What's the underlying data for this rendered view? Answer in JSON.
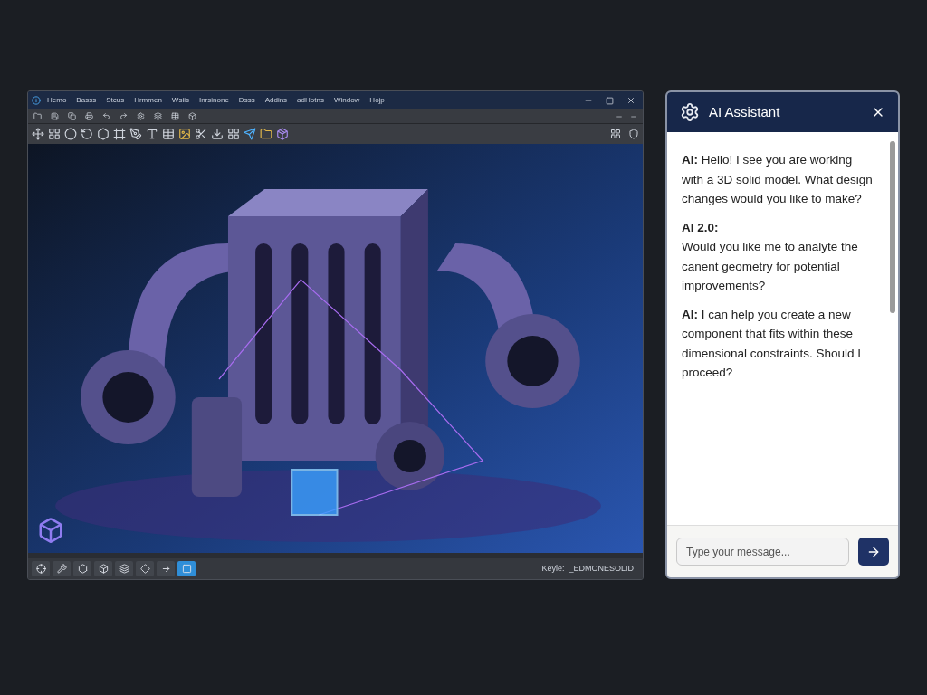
{
  "cad_window": {
    "menu": [
      "Hemo",
      "Basss",
      "Stcus",
      "Hrmmen",
      "Wsiis",
      "Inrsinone",
      "Dsss",
      "Addins",
      "adHotns",
      "Window",
      "Hojp"
    ],
    "bottom_tools": [
      {
        "selected": false
      },
      {
        "selected": false
      },
      {
        "selected": false
      },
      {
        "selected": false
      },
      {
        "selected": false
      },
      {
        "selected": false
      },
      {
        "selected": false
      },
      {
        "selected": true
      }
    ],
    "status": "Keyle:  _EDMONESOLID"
  },
  "assistant": {
    "title": "AI Assistant",
    "messages": [
      {
        "sender": "AI:",
        "sender_on_own_line": false,
        "text": "Hello! I see you are working with a 3D solid model. What design changes would you like to make?"
      },
      {
        "sender": "AI 2.0:",
        "sender_on_own_line": true,
        "text": "Would you like me to analyte the canent geometry for potential improvements?"
      },
      {
        "sender": "AI:",
        "sender_on_own_line": false,
        "text": "I can help you create a new component that fits within these dimensional constraints. Should I proceed?"
      }
    ],
    "input": {
      "placeholder": "Type your message..."
    }
  }
}
